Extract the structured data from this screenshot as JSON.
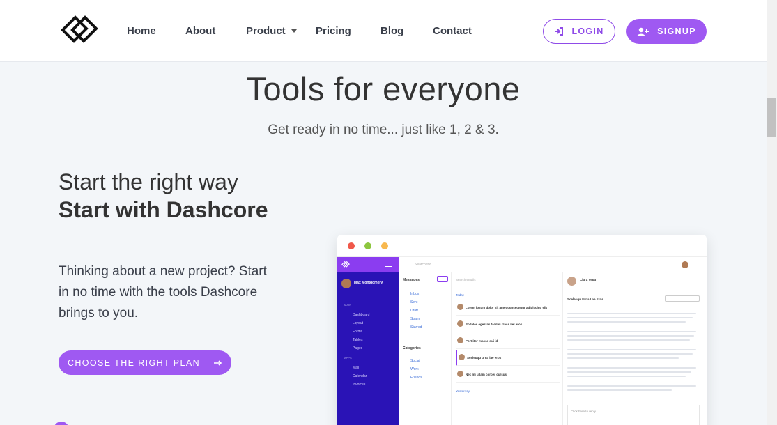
{
  "nav": {
    "items": [
      "Home",
      "About",
      "Product",
      "Pricing",
      "Blog",
      "Contact"
    ],
    "login_label": "LOGIN",
    "signup_label": "SIGNUP"
  },
  "hero": {
    "title": "Tools for everyone",
    "subtitle": "Get ready in no time... just like 1, 2 & 3."
  },
  "feature": {
    "line1": "Start the right way",
    "line2": "Start with Dashcore",
    "paragraph": "Thinking about a new project? Start in no time with the tools Dashcore brings to you.",
    "cta_label": "CHOOSE THE RIGHT PLAN"
  },
  "mockup": {
    "user_name": "Max Montgomery",
    "side_sections": [
      "MAIN",
      "APPS"
    ],
    "side_items": [
      "Dashboard",
      "Layout",
      "Forms",
      "Tables",
      "Pages",
      "Mail",
      "Calendar",
      "Invoices"
    ],
    "search_placeholder": "Search for...",
    "messages_label": "Messages",
    "folders": [
      "Inbox",
      "Sent",
      "Draft",
      "Spam",
      "Starred"
    ],
    "categories_label": "Categories",
    "categories": [
      "Social",
      "Work",
      "Friends"
    ],
    "search_emails": "Search emails",
    "today_label": "Today",
    "yesterday_label": "Yesterday",
    "threads": [
      "Lorem ipsum dolor sit amet consectetur adipiscing elit",
      "Sodales egestas facilisi class vel eros",
      "Porttitor massa dui id",
      "Sceleuqu urna lae eros",
      "Nec mi ullam corper cursus"
    ],
    "reader_name": "Clara Vega",
    "reader_subject": "Sceleuqu Urna Lae Eros",
    "reply_placeholder": "Click here to reply"
  },
  "colors": {
    "accent": "#9f59f2",
    "sidebar": "#2a13b6",
    "sidebar_top": "#8b3df0"
  }
}
